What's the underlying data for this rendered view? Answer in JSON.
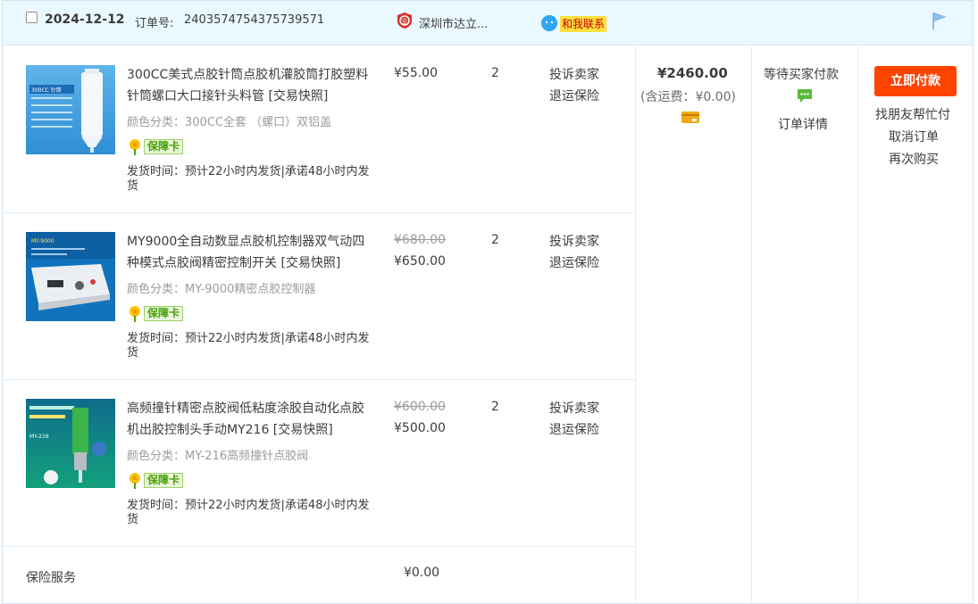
{
  "header": {
    "date": "2024-12-12",
    "order_no_label": "订单号:",
    "order_no": "2403574754375739571",
    "shop_name": "深圳市达立...",
    "contact_label": "和我联系",
    "flag_icon": "flag-icon",
    "shop_icon": "enterprise-shop-icon"
  },
  "items": [
    {
      "title": "300CC美式点胶针筒点胶机灌胶筒打胶塑料针筒螺口大口接针头料管 [交易快照]",
      "sku": "颜色分类：300CC全套 （螺口）双铝盖",
      "badge": "保障卡",
      "ship": "发货时间：预计22小时内发货|承诺48小时内发货",
      "price_old": "",
      "price": "¥55.00",
      "qty": "2",
      "complain": "投诉卖家",
      "insurance": "退运保险",
      "thumb_text": "300CC 针筒"
    },
    {
      "title": "MY9000全自动数显点胶机控制器双气动四种模式点胶阀精密控制开关 [交易快照]",
      "sku": "颜色分类：MY-9000精密点胶控制器",
      "badge": "保障卡",
      "ship": "发货时间：预计22小时内发货|承诺48小时内发货",
      "price_old": "¥680.00",
      "price": "¥650.00",
      "qty": "2",
      "complain": "投诉卖家",
      "insurance": "退运保险",
      "thumb_text": "MY-9000"
    },
    {
      "title": "高频撞针精密点胶阀低粘度涂胶自动化点胶机出胶控制头手动MY216 [交易快照]",
      "sku": "颜色分类：MY-216高频撞针点胶阀",
      "badge": "保障卡",
      "ship": "发货时间：预计22小时内发货|承诺48小时内发货",
      "price_old": "¥600.00",
      "price": "¥500.00",
      "qty": "2",
      "complain": "投诉卖家",
      "insurance": "退运保险",
      "thumb_text": "MY-216"
    }
  ],
  "summary": {
    "total": "¥2460.00",
    "freight": "(含运费：¥0.00)",
    "status": "等待买家付款",
    "detail": "订单详情"
  },
  "actions": {
    "pay": "立即付款",
    "friend_pay": "找朋友帮忙付",
    "cancel": "取消订单",
    "rebuy": "再次购买"
  },
  "insurance_service": {
    "label": "保险服务",
    "value": "¥0.00"
  },
  "colors": {
    "header_bg": "#eaf8ff",
    "pay_button": "#ff4400",
    "border": "#cfe4f5"
  }
}
